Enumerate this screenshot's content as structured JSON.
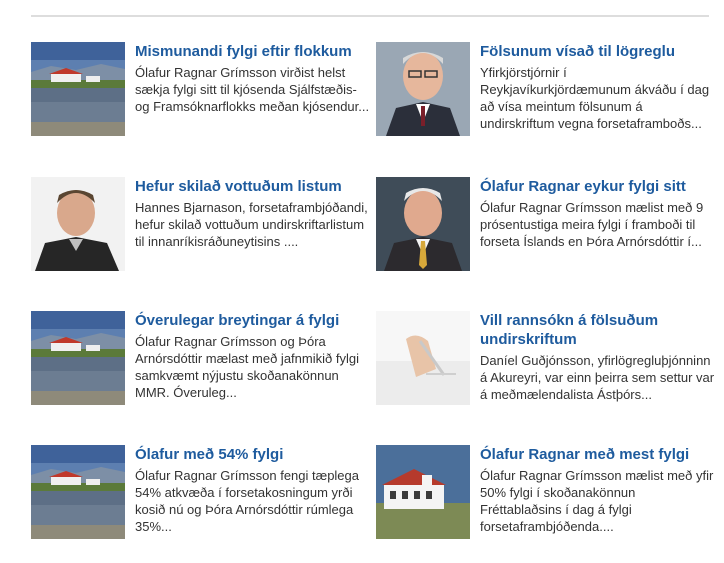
{
  "articles": [
    {
      "title": "Mismunandi fylgi eftir flokkum",
      "excerpt": "Ólafur Ragnar Grímsson virðist helst sækja fylgi sitt til kjósenda Sjálfstæðis- og Framsóknarflokks meðan kjósendur...",
      "image": "bessastadir-lake-photo"
    },
    {
      "title": "Fölsunum vísað til lögreglu",
      "excerpt": "Yfirkjörstjórnir í Reykjavíkurkjördæmunum ákváðu í dag að vísa meintum fölsunum á undirskriftum vegna forsetaframboðs...",
      "image": "older-man-glasses-portrait"
    },
    {
      "title": "Hefur skilað vottuðum listum",
      "excerpt": "Hannes Bjarnason, forsetaframbjóðandi, hefur skilað vottuðum undirskriftarlistum til innanríkisráðuneytisins ....",
      "image": "man-portrait"
    },
    {
      "title": "Ólafur Ragnar eykur fylgi sitt",
      "excerpt": "Ólafur Ragnar Grímsson mælist með 9 prósentustiga meira fylgi í framboði til forseta Íslands en Þóra Arnórsdóttir í...",
      "image": "white-haired-man-portrait"
    },
    {
      "title": "Óverulegar breytingar á fylgi",
      "excerpt": "Ólafur Ragnar Grímsson og Þóra Arnórsdóttir mælast með jafnmikið fylgi samkvæmt nýjustu skoðanakönnun MMR. Óveruleg...",
      "image": "bessastadir-lake-photo"
    },
    {
      "title": "Vill rannsókn á fölsuðum undirskriftum",
      "excerpt": "Daníel Guðjónsson, yfirlögregluþjónninn á Akureyri, var einn þeirra sem settur var á meðmælendalista Ástþórs...",
      "image": "signing-document-photo"
    },
    {
      "title": "Ólafur með 54% fylgi",
      "excerpt": "Ólafur Ragnar Grímsson fengi tæplega 54% atkvæða í forsetakosningum yrði kosið nú og Þóra Arnórsdóttir rúmlega 35%...",
      "image": "bessastadir-lake-photo"
    },
    {
      "title": "Ólafur Ragnar með mest fylgi",
      "excerpt": "Ólafur Ragnar Grímsson mælist með yfir 50% fylgi í skoðanakönnun Fréttablaðsins í dag á fylgi forsetaframbjóðenda....",
      "image": "white-building-photo"
    }
  ]
}
